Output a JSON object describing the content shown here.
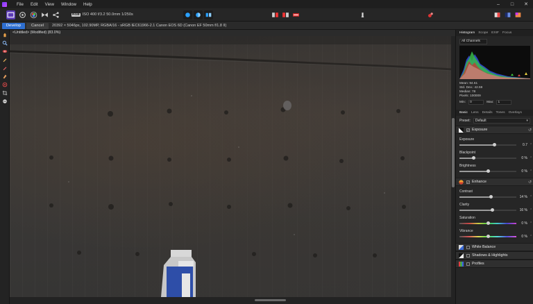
{
  "menu": {
    "items": [
      "File",
      "Edit",
      "View",
      "Window",
      "Help"
    ]
  },
  "toolbar": {
    "rgb_badge": "RGB",
    "camera_info": "ISO 400 f/3.2 50.0mm 1/250s"
  },
  "context_bar": {
    "develop_label": "Develop",
    "cancel_label": "Cancel",
    "image_info": "20392 × 5046px, 102.90MP, RGBA/16 - sRGB IEC61966-2.1     Canon EOS 6D (Canon EF 50mm f/1.8 II)"
  },
  "document": {
    "title": "<Untitled> (Modified) (83.0%)"
  },
  "histogram_panel": {
    "tabs": [
      "Histogram",
      "Scope",
      "EXIF",
      "Focus"
    ],
    "active_tab": "Histogram",
    "channel": "All Channels",
    "stats": [
      "Mean: 94.61",
      "Std. Dev.: 42.59",
      "Median: 78",
      "Pixels: 100009"
    ],
    "min_label": "Min:",
    "min_value": "0",
    "max_label": "Max:",
    "max_value": "1"
  },
  "develop_panel": {
    "tabs": [
      "Basic",
      "Lens",
      "Details",
      "Tones",
      "Overlays"
    ],
    "active_tab": "Basic",
    "preset_label": "Preset:",
    "preset_value": "Default",
    "exposure_section": {
      "label": "Exposure",
      "checked": true,
      "sliders": [
        {
          "label": "Exposure",
          "value": "0.7",
          "level": 0.62
        },
        {
          "label": "Blackpoint",
          "value": "0 %",
          "level": 0.25
        },
        {
          "label": "Brightness",
          "value": "0 %",
          "level": 0.5
        }
      ]
    },
    "enhance_section": {
      "label": "Enhance",
      "checked": true,
      "sliders": [
        {
          "label": "Contrast",
          "value": "14 %",
          "level": 0.56
        },
        {
          "label": "Clarity",
          "value": "16 %",
          "level": 0.58
        },
        {
          "label": "Saturation",
          "value": "0 %",
          "level": 0.5
        },
        {
          "label": "Vibrance",
          "value": "0 %",
          "level": 0.5
        }
      ]
    },
    "collapsed_sections": [
      "White Balance",
      "Shadows & Highlights",
      "Profiles"
    ]
  },
  "colors": {
    "accent": "#2e6fd0",
    "persona": "#5b3bb5"
  }
}
